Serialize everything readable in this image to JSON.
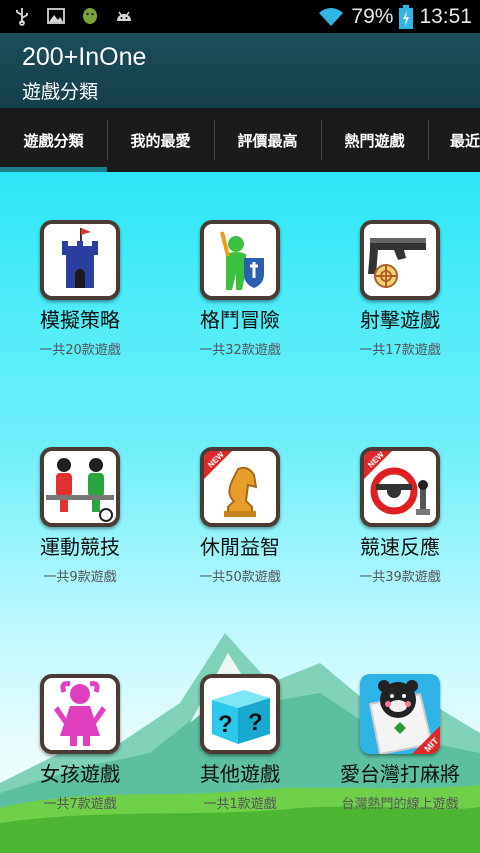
{
  "status_bar": {
    "notification_icons": [
      "usb-icon",
      "image-icon",
      "android-icon",
      "android-debug-icon"
    ],
    "wifi_icon": "wifi-icon",
    "battery_percent": "79%",
    "battery_icon": "battery-charging-icon",
    "time": "13:51"
  },
  "action_bar": {
    "title": "200+InOne",
    "subtitle": "遊戲分類"
  },
  "tabs": [
    {
      "label": "遊戲分類",
      "active": true
    },
    {
      "label": "我的最愛",
      "active": false
    },
    {
      "label": "評價最高",
      "active": false
    },
    {
      "label": "熱門遊戲",
      "active": false
    },
    {
      "label": "最近",
      "active": false
    }
  ],
  "categories": [
    {
      "name": "模擬策略",
      "count": "一共20款遊戲",
      "icon": "castle-icon"
    },
    {
      "name": "格鬥冒險",
      "count": "一共32款遊戲",
      "icon": "warrior-icon"
    },
    {
      "name": "射擊遊戲",
      "count": "一共17款遊戲",
      "icon": "gun-icon"
    },
    {
      "name": "運動競技",
      "count": "一共9款遊戲",
      "icon": "foosball-icon"
    },
    {
      "name": "休閒益智",
      "count": "一共50款遊戲",
      "icon": "chess-knight-icon",
      "badge": "NEW"
    },
    {
      "name": "競速反應",
      "count": "一共39款遊戲",
      "icon": "steering-wheel-icon",
      "badge": "NEW"
    },
    {
      "name": "女孩遊戲",
      "count": "一共7款遊戲",
      "icon": "girl-icon"
    },
    {
      "name": "其他遊戲",
      "count": "一共1款遊戲",
      "icon": "question-cube-icon"
    },
    {
      "name": "愛台灣打麻將",
      "count": "台灣熱門的線上遊戲",
      "icon": "mahjong-bear-icon",
      "badge": "MIT"
    }
  ],
  "colors": {
    "action_bar": "#1c4e5a",
    "tab_bar": "#1b1b1b",
    "tab_indicator": "#1e7f8c",
    "sky_top": "#2ce6f7",
    "grass": "#5cc43a"
  }
}
